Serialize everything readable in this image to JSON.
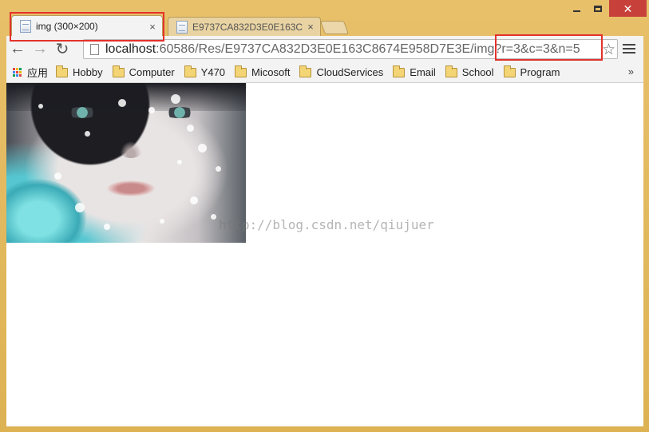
{
  "tabs": [
    {
      "title": "img (300×200)",
      "close": "×",
      "active": true
    },
    {
      "title": "E9737CA832D3E0E163C",
      "close": "×",
      "active": false
    }
  ],
  "window_controls": {
    "close": "✕"
  },
  "toolbar": {
    "back": "←",
    "forward": "→",
    "reload": "↻",
    "url_host": "localhost",
    "url_rest": ":60586/Res/E9737CA832D3E0E163C8674E958D7E3E/img?r=3&c=3&n=5",
    "star": "☆"
  },
  "bookmarks": {
    "apps_label": "应用",
    "items": [
      "Hobby",
      "Computer",
      "Y470",
      "Micosoft",
      "CloudServices",
      "Email",
      "School",
      "Program"
    ],
    "overflow": "»"
  },
  "content": {
    "watermark": "http://blog.csdn.net/qiujuer"
  },
  "colors": {
    "frame": "#e2b75a",
    "highlight": "#e3322c",
    "close_button": "#c7413a"
  }
}
